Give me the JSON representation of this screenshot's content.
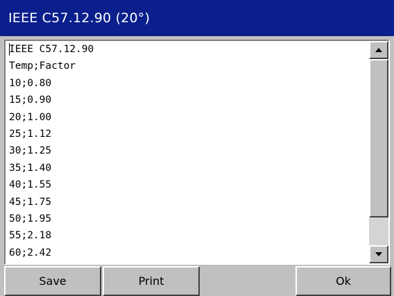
{
  "window": {
    "title": "IEEE C57.12.90 (20°)"
  },
  "content": {
    "lines": [
      "IEEE C57.12.90",
      "Temp;Factor",
      "10;0.80",
      "15;0.90",
      "20;1.00",
      "25;1.12",
      "30;1.25",
      "35;1.40",
      "40;1.55",
      "45;1.75",
      "50;1.95",
      "55;2.18",
      "60;2.42"
    ]
  },
  "buttons": {
    "save": "Save",
    "print": "Print",
    "ok": "Ok"
  },
  "colors": {
    "titlebar": "#0a1f8c",
    "title_text": "#ffffff",
    "face": "#c0c0c0",
    "text_bg": "#ffffff"
  },
  "icons": {
    "scroll_up": "triangle-up-icon",
    "scroll_down": "triangle-down-icon"
  }
}
